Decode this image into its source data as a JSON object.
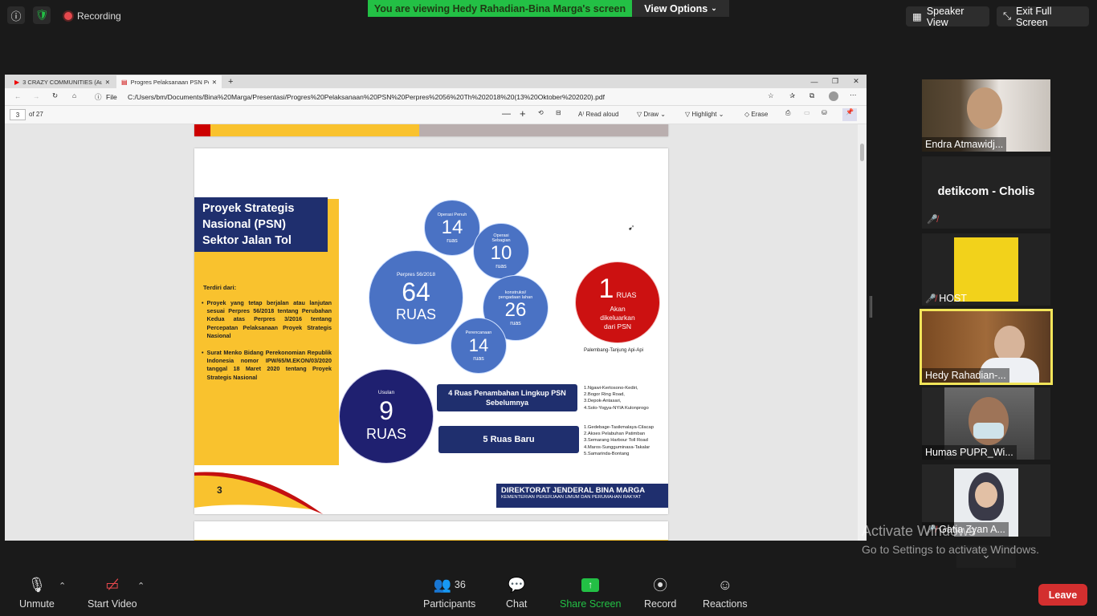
{
  "top": {
    "recording_label": "Recording",
    "banner": "You are viewing Hedy Rahadian-Bina Marga's screen",
    "view_options": "View Options",
    "speaker_view": "Speaker View",
    "exit_full_screen": "Exit Full Screen"
  },
  "browser": {
    "tab1": "3 CRAZY COMMUNITIES (Auror...",
    "tab2": "Progres Pelaksanaan PSN Perpre...",
    "file_label": "File",
    "url": "C:/Users/bm/Documents/Bina%20Marga/Presentasi/Progres%20Pelaksanaan%20PSN%20Perpres%2056%20Th%202018%20(13%20Oktober%202020).pdf",
    "page_num": "3",
    "page_of": "of 27",
    "read_aloud": "Read aloud",
    "draw": "Draw",
    "highlight": "Highlight",
    "erase": "Erase"
  },
  "slide": {
    "title_l1": "Proyek Strategis",
    "title_l2": "Nasional (PSN)",
    "title_l3": "Sektor Jalan Tol",
    "terdiri": "Terdiri dari:",
    "bullet1": "Proyek yang tetap berjalan atau lanjutan sesuai Perpres 56/2018 tentang Perubahan Kedua atas Perpres 3/2016 tentang Percepatan Pelaksanaan Proyek Strategis Nasional",
    "bullet2": "Surat Menko Bidang Perekonomian Republik Indonesia nomor IPW/65/M.EKON/03/2020 tanggal 18 Maret 2020 tentang Proyek Strategis Nasional",
    "c_main_top": "Perpres 56/2018",
    "c_main_num": "64",
    "c_main_unit": "RUAS",
    "c_op_full_top": "Operasi Penuh",
    "c_op_full_num": "14",
    "c_op_full_unit": "ruas",
    "c_op_part_top": "Operasi Sebagian",
    "c_op_part_num": "10",
    "c_op_part_unit": "ruas",
    "c_kons_top": "konstruksi/ pengadaan lahan",
    "c_kons_num": "26",
    "c_kons_unit": "ruas",
    "c_renc_top": "Perencanaan",
    "c_renc_num": "14",
    "c_renc_unit": "ruas",
    "c_red_num": "1",
    "c_red_unit": "RUAS",
    "c_red_text": "Akan dikeluarkan dari PSN",
    "red_caption": "Palembang-Tanjung Api-Api",
    "c_usulan_top": "Usulan",
    "c_usulan_num": "9",
    "c_usulan_unit": "RUAS",
    "btn1": "4 Ruas Penambahan Lingkup PSN Sebelumnya",
    "btn2": "5 Ruas Baru",
    "list1": [
      "1.Ngawi-Kertosono-Kediri,",
      "2.Bogor Ring Road,",
      "3.Depok-Antasari,",
      "4.Solo-Yogya-NYIA Kulonprogo"
    ],
    "list2": [
      "1.Gedebage-Tasikmalaya-Cilacap",
      "2.Akses Pelabuhan Patimban",
      "3.Semarang Harbour Toll Road",
      "4.Maros-Sungguminasa-Takalar",
      "5.Samarinda-Bontang"
    ],
    "page_no": "3",
    "footer1": "DIREKTORAT JENDERAL BINA MARGA",
    "footer2": "KEMENTERIAN PEKERJAAN UMUM DAN PERUMAHAN RAKYAT"
  },
  "participants": {
    "p1": "Endra Atmawidj...",
    "p2": "detikcom - Cholis",
    "p3": "HOST",
    "p4": "Hedy Rahadian-...",
    "p5": "Humas PUPR_Wi...",
    "p6": "Gatia Zyan A..."
  },
  "watermark": {
    "line1": "Activate Windows",
    "line2": "Go to Settings to activate Windows."
  },
  "bottom": {
    "unmute": "Unmute",
    "start_video": "Start Video",
    "participants_count": "36",
    "participants": "Participants",
    "chat": "Chat",
    "share_screen": "Share Screen",
    "record": "Record",
    "reactions": "Reactions",
    "leave": "Leave"
  },
  "colors": {
    "share_green": "#23c045",
    "slide_yellow": "#f9c22e",
    "slide_navy": "#1f2f6e",
    "circle_blue": "#4a72c4",
    "circle_red": "#cc1111",
    "leave_red": "#d32f2f"
  }
}
